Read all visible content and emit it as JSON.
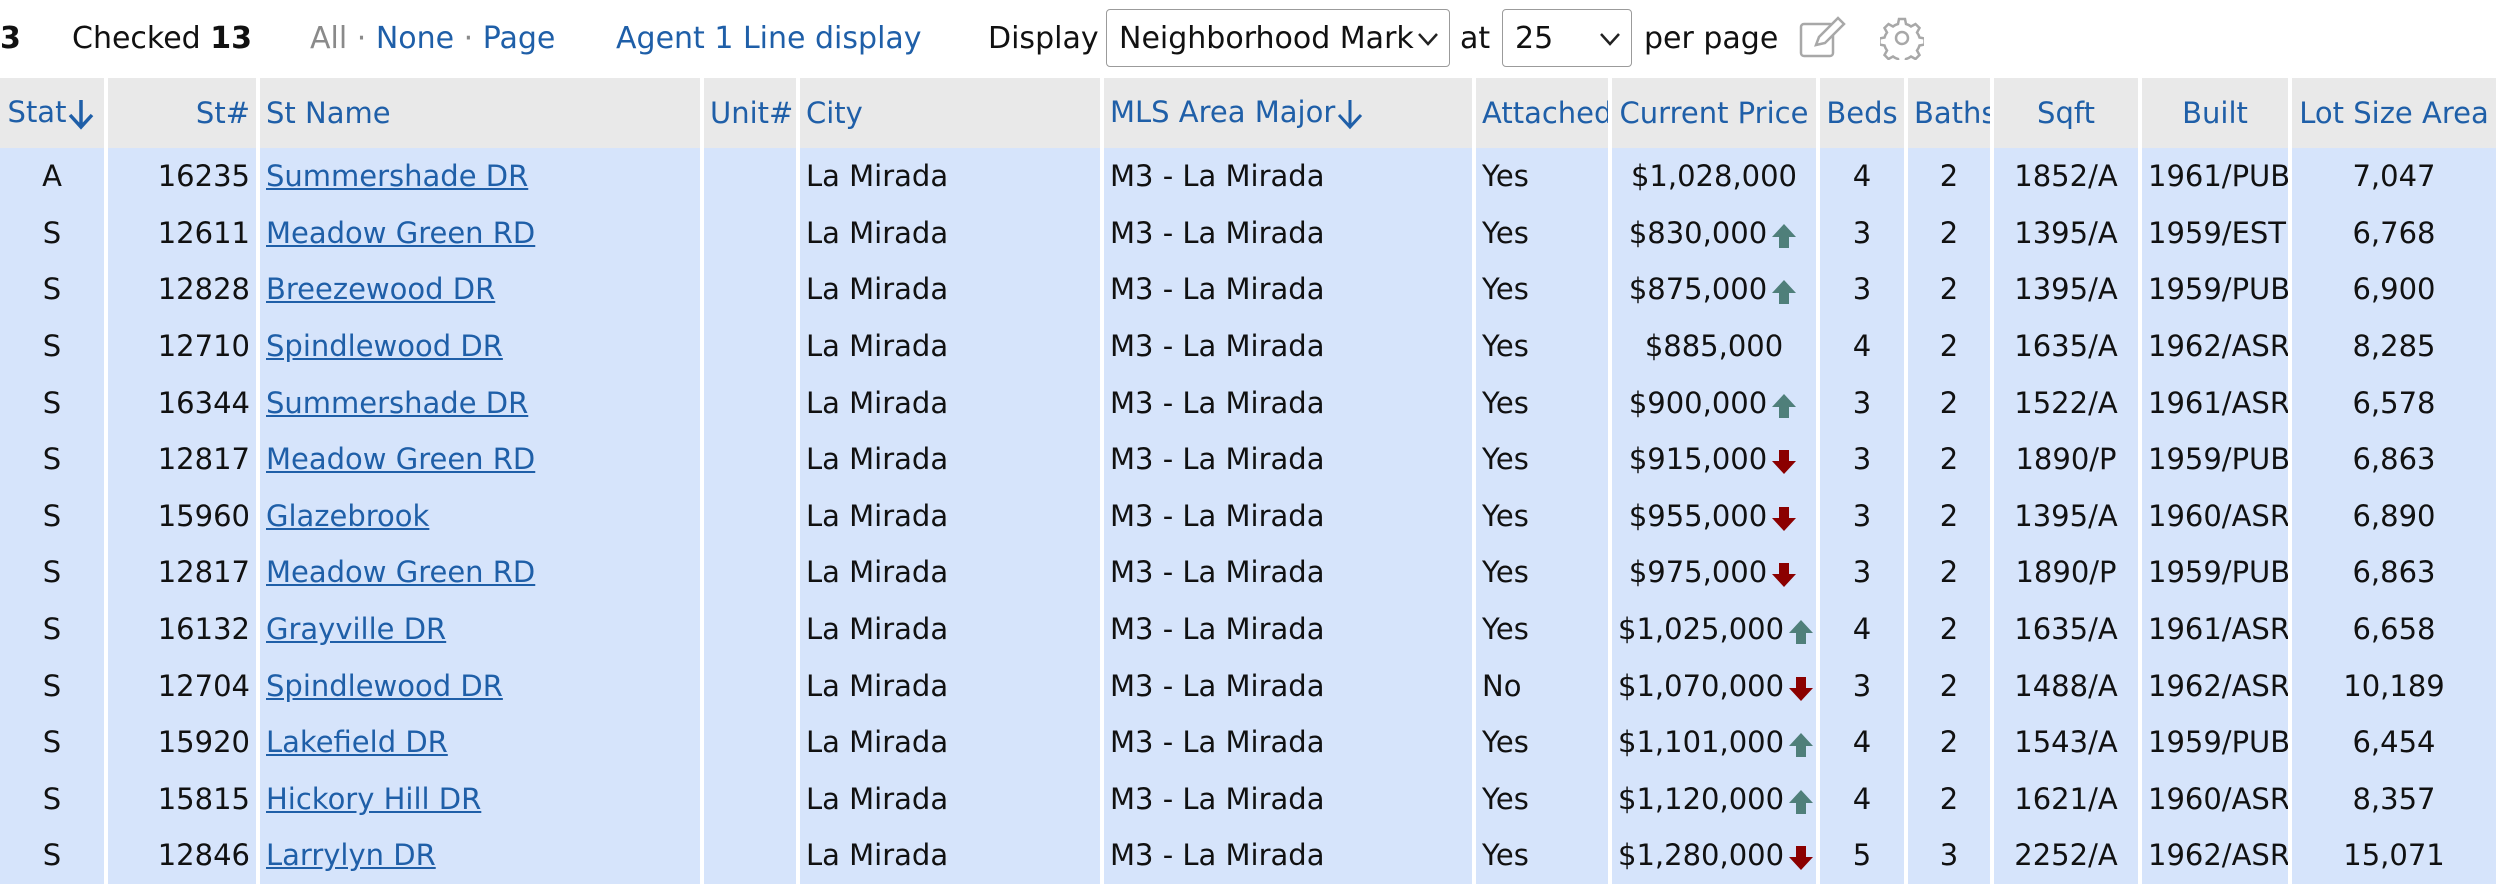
{
  "toolbar": {
    "count_fragment": "3",
    "checked_label": "Checked",
    "checked_count": "13",
    "all": "All",
    "sep1": " · ",
    "none": "None",
    "sep2": " · ",
    "page": "Page",
    "agent_display": "Agent 1 Line display",
    "display_label": "Display",
    "display_value": "Neighborhood Mark",
    "at_label": "at",
    "per_page_value": "25",
    "per_page_label": "per page",
    "edit_icon": "pencil-edit-icon",
    "settings_icon": "gear-icon"
  },
  "columns": [
    "Stat",
    "St#",
    "St Name",
    "Unit#",
    "City",
    "MLS Area Major",
    "Attached",
    "Current Price",
    "Beds",
    "Baths",
    "Sqft",
    "Built",
    "Lot Size Area"
  ],
  "sorted_columns": [
    "Stat",
    "MLS Area Major"
  ],
  "colors": {
    "link": "#1f5fa8",
    "row_bg": "#d6e4fb",
    "header_bg": "#e9e9e9",
    "price_up": "#4f7f7a",
    "price_down": "#8b0000"
  },
  "rows": [
    {
      "stat": "A",
      "stno": "16235",
      "stname": "Summershade DR",
      "unit": "",
      "city": "La Mirada",
      "area": "M3 - La Mirada",
      "attached": "Yes",
      "price": "$1,028,000",
      "trend": "none",
      "beds": "4",
      "baths": "2",
      "sqft": "1852/A",
      "built": "1961/PUB",
      "lot": "7,047"
    },
    {
      "stat": "S",
      "stno": "12611",
      "stname": "Meadow Green RD",
      "unit": "",
      "city": "La Mirada",
      "area": "M3 - La Mirada",
      "attached": "Yes",
      "price": "$830,000",
      "trend": "up",
      "beds": "3",
      "baths": "2",
      "sqft": "1395/A",
      "built": "1959/EST",
      "lot": "6,768"
    },
    {
      "stat": "S",
      "stno": "12828",
      "stname": "Breezewood DR",
      "unit": "",
      "city": "La Mirada",
      "area": "M3 - La Mirada",
      "attached": "Yes",
      "price": "$875,000",
      "trend": "up",
      "beds": "3",
      "baths": "2",
      "sqft": "1395/A",
      "built": "1959/PUB",
      "lot": "6,900"
    },
    {
      "stat": "S",
      "stno": "12710",
      "stname": "Spindlewood DR",
      "unit": "",
      "city": "La Mirada",
      "area": "M3 - La Mirada",
      "attached": "Yes",
      "price": "$885,000",
      "trend": "none",
      "beds": "4",
      "baths": "2",
      "sqft": "1635/A",
      "built": "1962/ASR",
      "lot": "8,285"
    },
    {
      "stat": "S",
      "stno": "16344",
      "stname": "Summershade DR",
      "unit": "",
      "city": "La Mirada",
      "area": "M3 - La Mirada",
      "attached": "Yes",
      "price": "$900,000",
      "trend": "up",
      "beds": "3",
      "baths": "2",
      "sqft": "1522/A",
      "built": "1961/ASR",
      "lot": "6,578"
    },
    {
      "stat": "S",
      "stno": "12817",
      "stname": "Meadow Green RD",
      "unit": "",
      "city": "La Mirada",
      "area": "M3 - La Mirada",
      "attached": "Yes",
      "price": "$915,000",
      "trend": "down",
      "beds": "3",
      "baths": "2",
      "sqft": "1890/P",
      "built": "1959/PUB",
      "lot": "6,863"
    },
    {
      "stat": "S",
      "stno": "15960",
      "stname": "Glazebrook",
      "unit": "",
      "city": "La Mirada",
      "area": "M3 - La Mirada",
      "attached": "Yes",
      "price": "$955,000",
      "trend": "down",
      "beds": "3",
      "baths": "2",
      "sqft": "1395/A",
      "built": "1960/ASR",
      "lot": "6,890"
    },
    {
      "stat": "S",
      "stno": "12817",
      "stname": "Meadow Green RD",
      "unit": "",
      "city": "La Mirada",
      "area": "M3 - La Mirada",
      "attached": "Yes",
      "price": "$975,000",
      "trend": "down",
      "beds": "3",
      "baths": "2",
      "sqft": "1890/P",
      "built": "1959/PUB",
      "lot": "6,863"
    },
    {
      "stat": "S",
      "stno": "16132",
      "stname": "Grayville DR",
      "unit": "",
      "city": "La Mirada",
      "area": "M3 - La Mirada",
      "attached": "Yes",
      "price": "$1,025,000",
      "trend": "up",
      "beds": "4",
      "baths": "2",
      "sqft": "1635/A",
      "built": "1961/ASR",
      "lot": "6,658"
    },
    {
      "stat": "S",
      "stno": "12704",
      "stname": "Spindlewood DR",
      "unit": "",
      "city": "La Mirada",
      "area": "M3 - La Mirada",
      "attached": "No",
      "price": "$1,070,000",
      "trend": "down",
      "beds": "3",
      "baths": "2",
      "sqft": "1488/A",
      "built": "1962/ASR",
      "lot": "10,189"
    },
    {
      "stat": "S",
      "stno": "15920",
      "stname": "Lakefield DR",
      "unit": "",
      "city": "La Mirada",
      "area": "M3 - La Mirada",
      "attached": "Yes",
      "price": "$1,101,000",
      "trend": "up",
      "beds": "4",
      "baths": "2",
      "sqft": "1543/A",
      "built": "1959/PUB",
      "lot": "6,454"
    },
    {
      "stat": "S",
      "stno": "15815",
      "stname": "Hickory Hill DR",
      "unit": "",
      "city": "La Mirada",
      "area": "M3 - La Mirada",
      "attached": "Yes",
      "price": "$1,120,000",
      "trend": "up",
      "beds": "4",
      "baths": "2",
      "sqft": "1621/A",
      "built": "1960/ASR",
      "lot": "8,357"
    },
    {
      "stat": "S",
      "stno": "12846",
      "stname": "Larrylyn DR",
      "unit": "",
      "city": "La Mirada",
      "area": "M3 - La Mirada",
      "attached": "Yes",
      "price": "$1,280,000",
      "trend": "down",
      "beds": "5",
      "baths": "3",
      "sqft": "2252/A",
      "built": "1962/ASR",
      "lot": "15,071"
    }
  ]
}
